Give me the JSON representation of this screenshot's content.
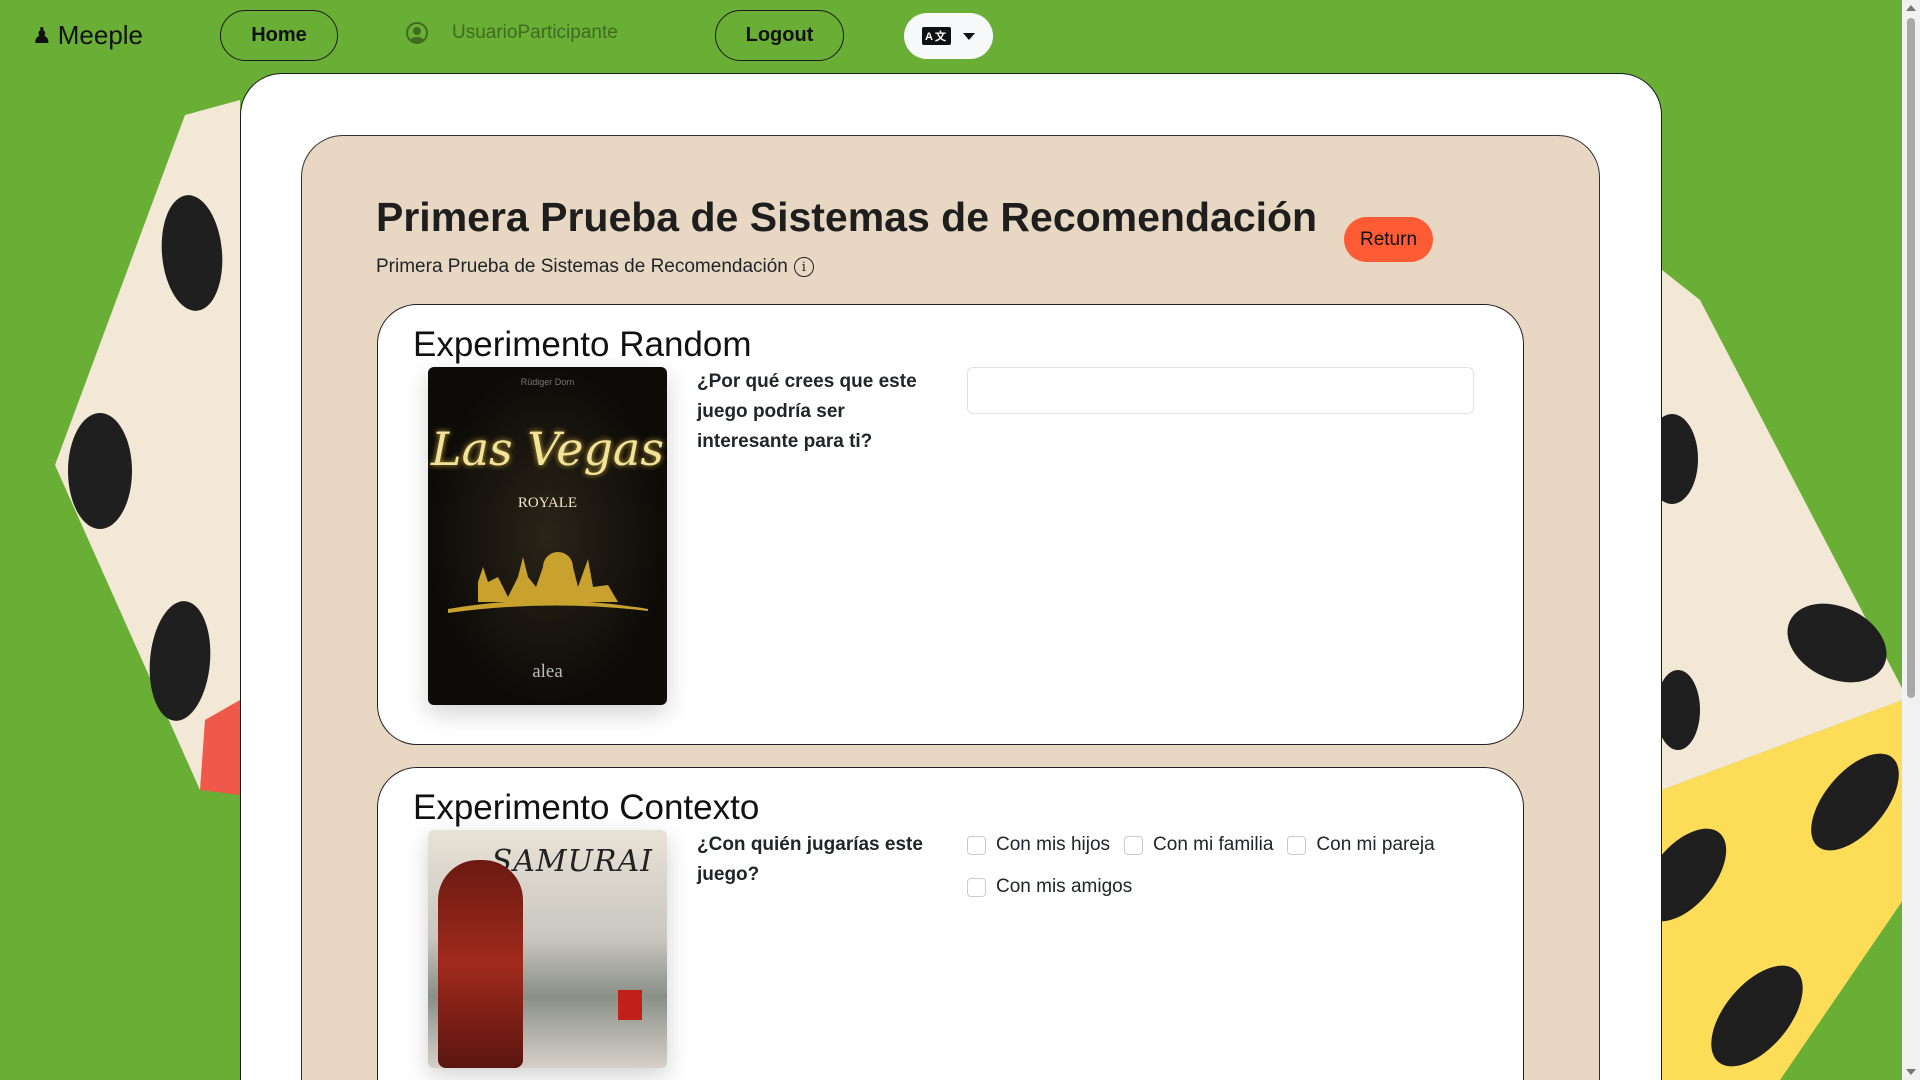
{
  "nav": {
    "brand": "Meeple",
    "home_label": "Home",
    "username": "UsuarioParticipante",
    "logout_label": "Logout",
    "language_icon_text": "A文"
  },
  "page": {
    "title": "Primera Prueba de Sistemas de Recomendación",
    "subtitle": "Primera Prueba de Sistemas de Recomendación",
    "info_icon": "i",
    "return_label": "Return"
  },
  "experiments": [
    {
      "title": "Experimento Random",
      "cover": {
        "author": "Rüdiger Dorn",
        "name": "Las Vegas",
        "sub": "ROYALE",
        "publisher": "alea"
      },
      "question": "¿Por qué crees que este juego podría ser interesante para ti?",
      "answer_value": "",
      "answer_placeholder": ""
    },
    {
      "title": "Experimento Contexto",
      "cover": {
        "name": "SAMURAI"
      },
      "question": "¿Con quién jugarías este juego?",
      "options": [
        {
          "label": "Con mis hijos",
          "checked": false
        },
        {
          "label": "Con mi familia",
          "checked": false
        },
        {
          "label": "Con mi pareja",
          "checked": false
        },
        {
          "label": "Con mis amigos",
          "checked": false
        }
      ]
    }
  ],
  "colors": {
    "background": "#6aaf35",
    "panel": "#e8d8c3",
    "return": "#ff5c35"
  }
}
